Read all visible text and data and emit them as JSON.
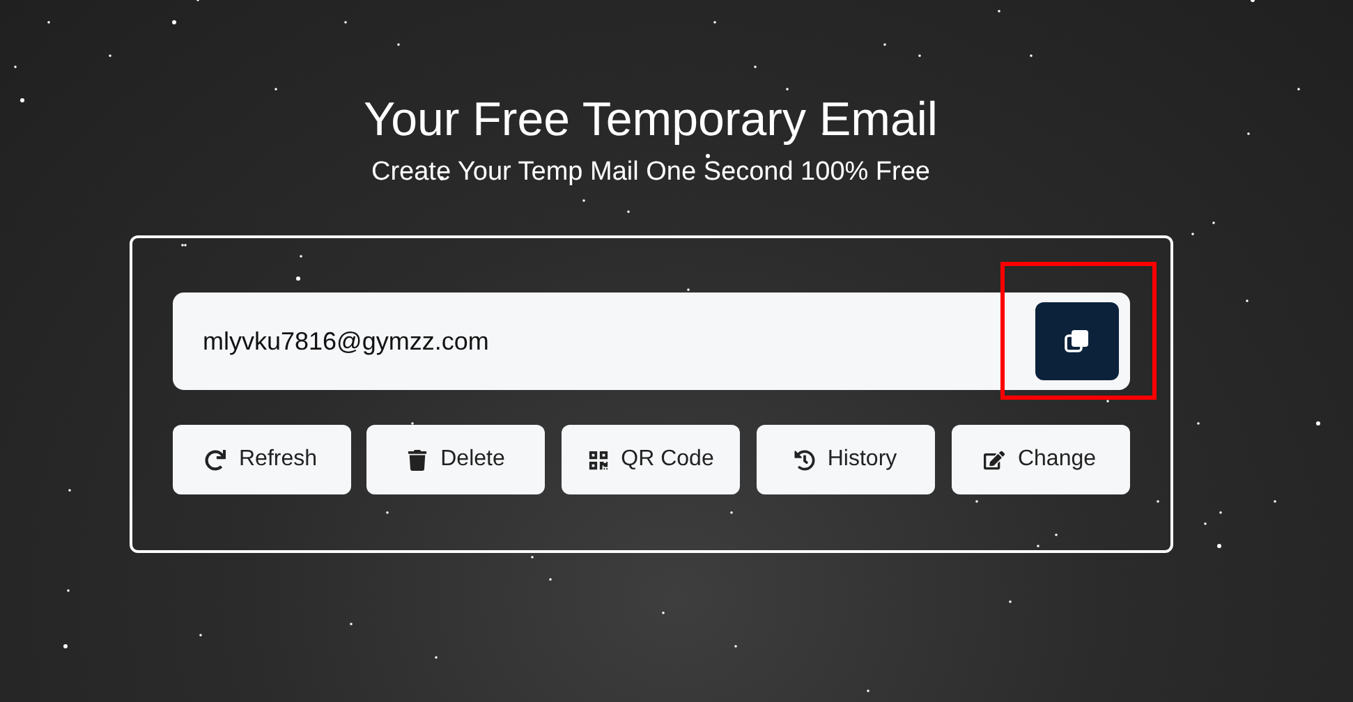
{
  "title": "Your Free Temporary Email",
  "subtitle": "Create Your Temp Mail One Second 100% Free",
  "email_field": {
    "value": "mlyvku7816@gymzz.com"
  },
  "copy_button": {
    "highlighted": true
  },
  "actions": [
    {
      "kind": "refresh",
      "label": "Refresh"
    },
    {
      "kind": "delete",
      "label": "Delete"
    },
    {
      "kind": "qr",
      "label": "QR Code"
    },
    {
      "kind": "history",
      "label": "History"
    },
    {
      "kind": "change",
      "label": "Change"
    }
  ]
}
